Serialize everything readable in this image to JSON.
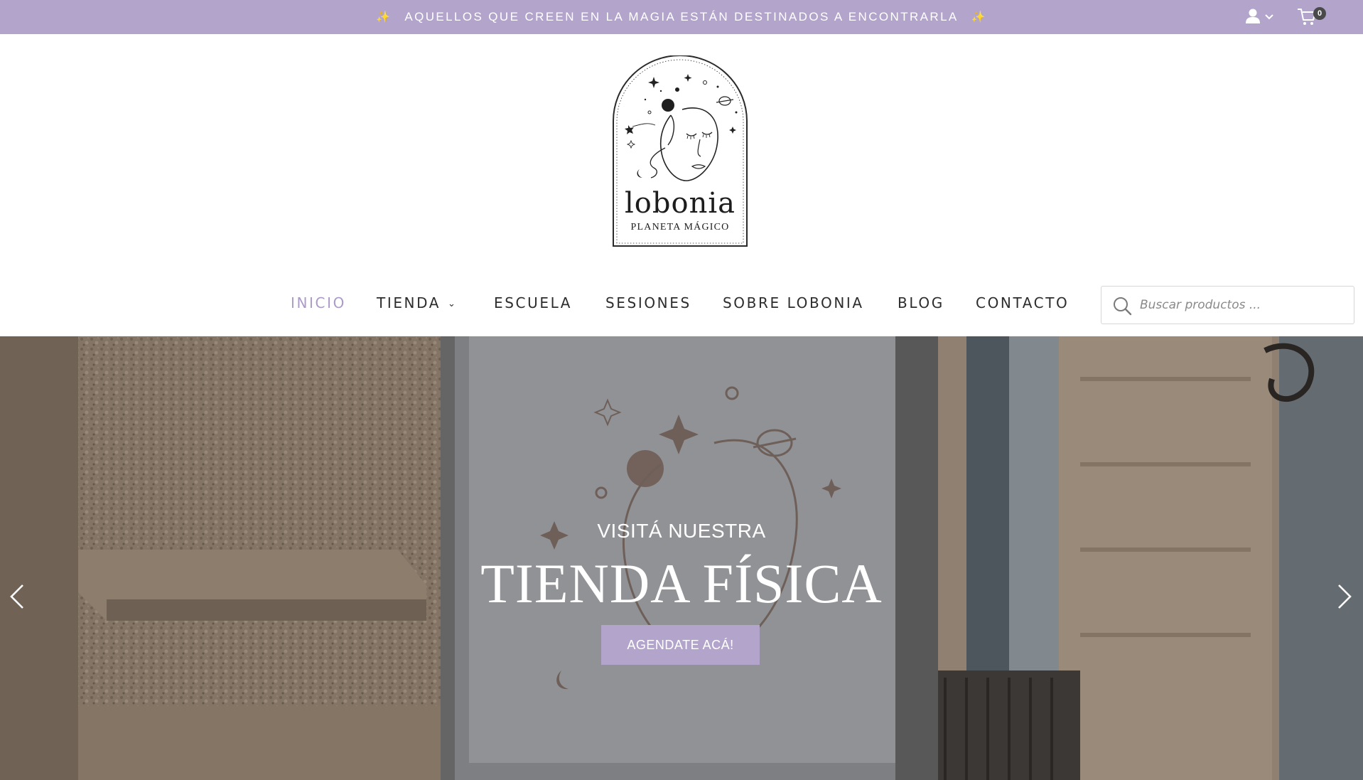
{
  "topbar": {
    "message": "AQUELLOS QUE CREEN EN LA MAGIA ESTÁN DESTINADOS A ENCONTRARLA",
    "sparkle": "✨",
    "cart_count": "0",
    "bg_color": "#b3a4cc"
  },
  "logo": {
    "name": "lobonia",
    "subtitle": "PLANETA MÁGICO"
  },
  "nav": {
    "items": [
      {
        "label": "INICIO",
        "active": true
      },
      {
        "label": "TIENDA",
        "has_dropdown": true
      },
      {
        "label": "ESCUELA"
      },
      {
        "label": "SESIONES"
      },
      {
        "label": "SOBRE LOBONIA"
      },
      {
        "label": "BLOG"
      },
      {
        "label": "CONTACTO"
      }
    ],
    "active_color": "#ac9bc9",
    "search_placeholder": "Buscar productos ..."
  },
  "hero": {
    "kicker": "VISITÁ NUESTRA",
    "title": "TIENDA FÍSICA",
    "button_label": "AGENDATE ACÁ!",
    "button_color": "#b3a4cc"
  },
  "icons": {
    "user": "user-icon",
    "cart": "cart-icon",
    "search": "search-icon",
    "prev": "chevron-left-icon",
    "next": "chevron-right-icon"
  }
}
